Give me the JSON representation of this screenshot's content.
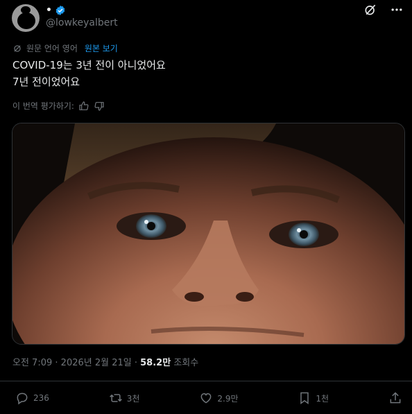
{
  "author": {
    "display_name": "•",
    "handle": "@lowkeyalbert",
    "verified": true
  },
  "translation": {
    "notice": "원문 언어 영어",
    "show_original": "원본 보기"
  },
  "tweet": {
    "lines": [
      "COVID-19는 3년 전이 아니었어요",
      "7년 전이었어요"
    ]
  },
  "rate_translation": {
    "label": "이 번역 평가하기:"
  },
  "meta": {
    "time": "오전 7:09",
    "separator": "·",
    "date": "2026년 2월 21일",
    "views_value": "58.2만",
    "views_label": "조회수"
  },
  "actions": {
    "replies": "236",
    "reposts": "3천",
    "likes": "2.9만",
    "bookmarks": "1천"
  },
  "icons": [
    "avatar",
    "verified-badge-icon",
    "grok-icon",
    "more-icon",
    "translate-icon",
    "thumbs-up-icon",
    "thumbs-down-icon",
    "reply-icon",
    "repost-icon",
    "like-icon",
    "bookmark-icon",
    "share-icon"
  ],
  "colors": {
    "background": "#000000",
    "text": "#e7e9ea",
    "muted": "#71767b",
    "accent": "#1d9bf0"
  }
}
